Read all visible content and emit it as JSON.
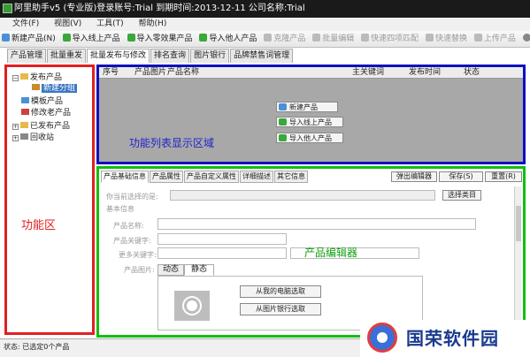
{
  "window": {
    "title": "阿里助手v5 (专业版)登录账号:Trial  到期时间:2013-12-11    公司名称:Trial"
  },
  "menu": [
    "文件(F)",
    "视图(V)",
    "工具(T)",
    "帮助(H)"
  ],
  "toolbar": [
    {
      "label": "新建产品(N)",
      "icon": "new-doc-icon",
      "color": "#4a90d9",
      "enabled": true
    },
    {
      "label": "导入线上产品",
      "icon": "import-green-icon",
      "color": "#3aa83a",
      "enabled": true
    },
    {
      "label": "导入零效果产品",
      "icon": "import-green-icon",
      "color": "#3aa83a",
      "enabled": true
    },
    {
      "label": "导入他人产品",
      "icon": "import-green-icon",
      "color": "#3aa83a",
      "enabled": true
    },
    {
      "label": "克隆产品",
      "icon": "clone-icon",
      "color": "#bbbbbb",
      "enabled": false
    },
    {
      "label": "批量编辑",
      "icon": "batch-edit-icon",
      "color": "#bbbbbb",
      "enabled": false
    },
    {
      "label": "快速四项匹配",
      "icon": "match-icon",
      "color": "#bbbbbb",
      "enabled": false
    },
    {
      "label": "快速替换",
      "icon": "replace-icon",
      "color": "#bbbbbb",
      "enabled": false
    },
    {
      "label": "上传产品",
      "icon": "upload-icon",
      "color": "#bbbbbb",
      "enabled": false
    }
  ],
  "main_tabs": [
    "产品管理",
    "批量重发",
    "批量发布与修改",
    "排名查询",
    "图片银行",
    "品牌禁售词管理"
  ],
  "tree": {
    "items": [
      {
        "label": "发布产品",
        "level": 0
      },
      {
        "label": "新建分组",
        "level": 1,
        "selected": true
      },
      {
        "label": "模板产品",
        "level": 0
      },
      {
        "label": "修改老产品",
        "level": 0
      },
      {
        "label": "已发布产品",
        "level": 0
      },
      {
        "label": "回收站",
        "level": 0
      }
    ]
  },
  "list": {
    "columns": [
      "序号",
      "产品图片",
      "产品名称",
      "主关键词",
      "发布时间",
      "状态"
    ],
    "actions": [
      "新建产品",
      "导入线上产品",
      "导入他人产品"
    ],
    "annotation": "功能列表显示区域"
  },
  "left_annotation": "功能区",
  "editor": {
    "tabs": [
      "产品基础信息",
      "产品属性",
      "产品自定义属性",
      "详细描述",
      "其它信息"
    ],
    "buttons": [
      "弹出编辑器",
      "保存(S)",
      "重置(R)"
    ],
    "category_label": "你当前选择的是:",
    "choose_category": "选择类目",
    "section_basic": "基本信息",
    "name_label": "产品名称:",
    "keyword_label": "产品关键字:",
    "more_keywords_label": "更多关键字:",
    "image_label": "产品图片:",
    "image_tabs": [
      "动态",
      "静态"
    ],
    "pick_from_computer": "从我的电脑选取",
    "pick_from_bank": "从图片银行选取",
    "annotation": "产品编辑器"
  },
  "status": {
    "text": "状态:  已选定0个产品"
  },
  "watermark": {
    "text": "国荣软件园"
  },
  "colors": {
    "left_frame": "#e02020",
    "list_frame": "#1010c0",
    "editor_frame": "#10c010"
  }
}
